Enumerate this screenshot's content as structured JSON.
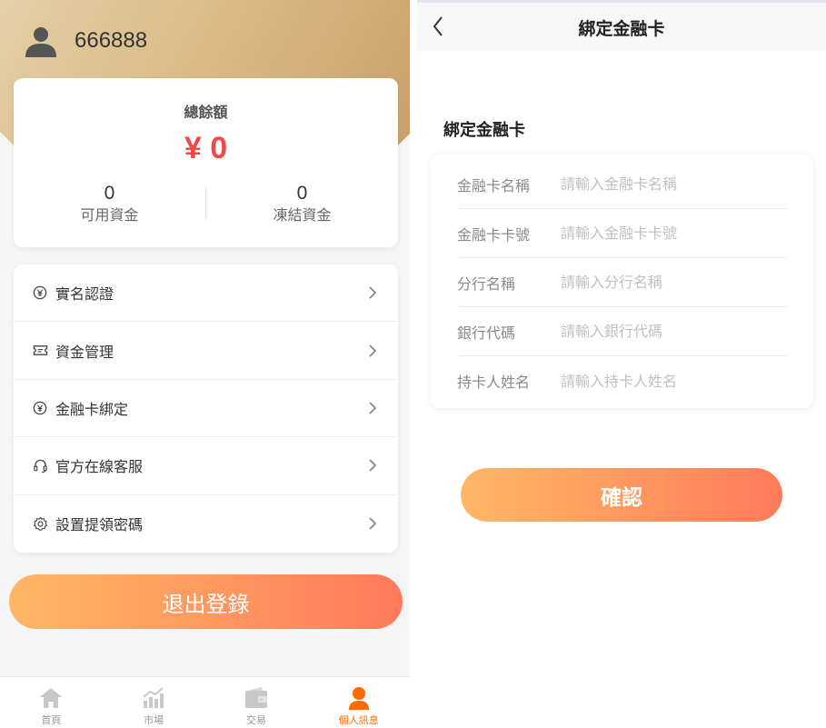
{
  "profile": {
    "username": "666888",
    "balance": {
      "title": "總餘額",
      "amount": "¥ 0",
      "available_value": "0",
      "available_label": "可用資金",
      "frozen_value": "0",
      "frozen_label": "凍結資金"
    },
    "menu": [
      {
        "label": "實名認證",
        "icon": "yuan-circle-icon"
      },
      {
        "label": "資金管理",
        "icon": "ticket-icon"
      },
      {
        "label": "金融卡綁定",
        "icon": "yuan-circle-icon"
      },
      {
        "label": "官方在線客服",
        "icon": "headset-icon"
      },
      {
        "label": "設置提領密碼",
        "icon": "gear-icon"
      }
    ],
    "logout_label": "退出登錄"
  },
  "tabbar": {
    "tabs": [
      {
        "label": "首頁",
        "icon": "home-icon"
      },
      {
        "label": "市場",
        "icon": "chart-icon"
      },
      {
        "label": "交易",
        "icon": "wallet-icon"
      },
      {
        "label": "個人訊息",
        "icon": "person-icon"
      }
    ],
    "active_index": 3
  },
  "bind_card": {
    "nav_title": "綁定金融卡",
    "section_title": "綁定金融卡",
    "fields": [
      {
        "label": "金融卡名稱",
        "placeholder": "請輸入金融卡名稱",
        "value": ""
      },
      {
        "label": "金融卡卡號",
        "placeholder": "請輸入金融卡卡號",
        "value": ""
      },
      {
        "label": "分行名稱",
        "placeholder": "請輸入分行名稱",
        "value": ""
      },
      {
        "label": "銀行代碼",
        "placeholder": "請輸入銀行代碼",
        "value": ""
      },
      {
        "label": "持卡人姓名",
        "placeholder": "請輸入持卡人姓名",
        "value": ""
      }
    ],
    "confirm_label": "確認"
  },
  "colors": {
    "gold_header": "#d9b985",
    "balance_red": "#f04848",
    "button_gradient_start": "#ffb765",
    "button_gradient_end": "#ff7a5a",
    "active_tab": "#ff6a00",
    "inactive_tab": "#c8c8c8"
  }
}
